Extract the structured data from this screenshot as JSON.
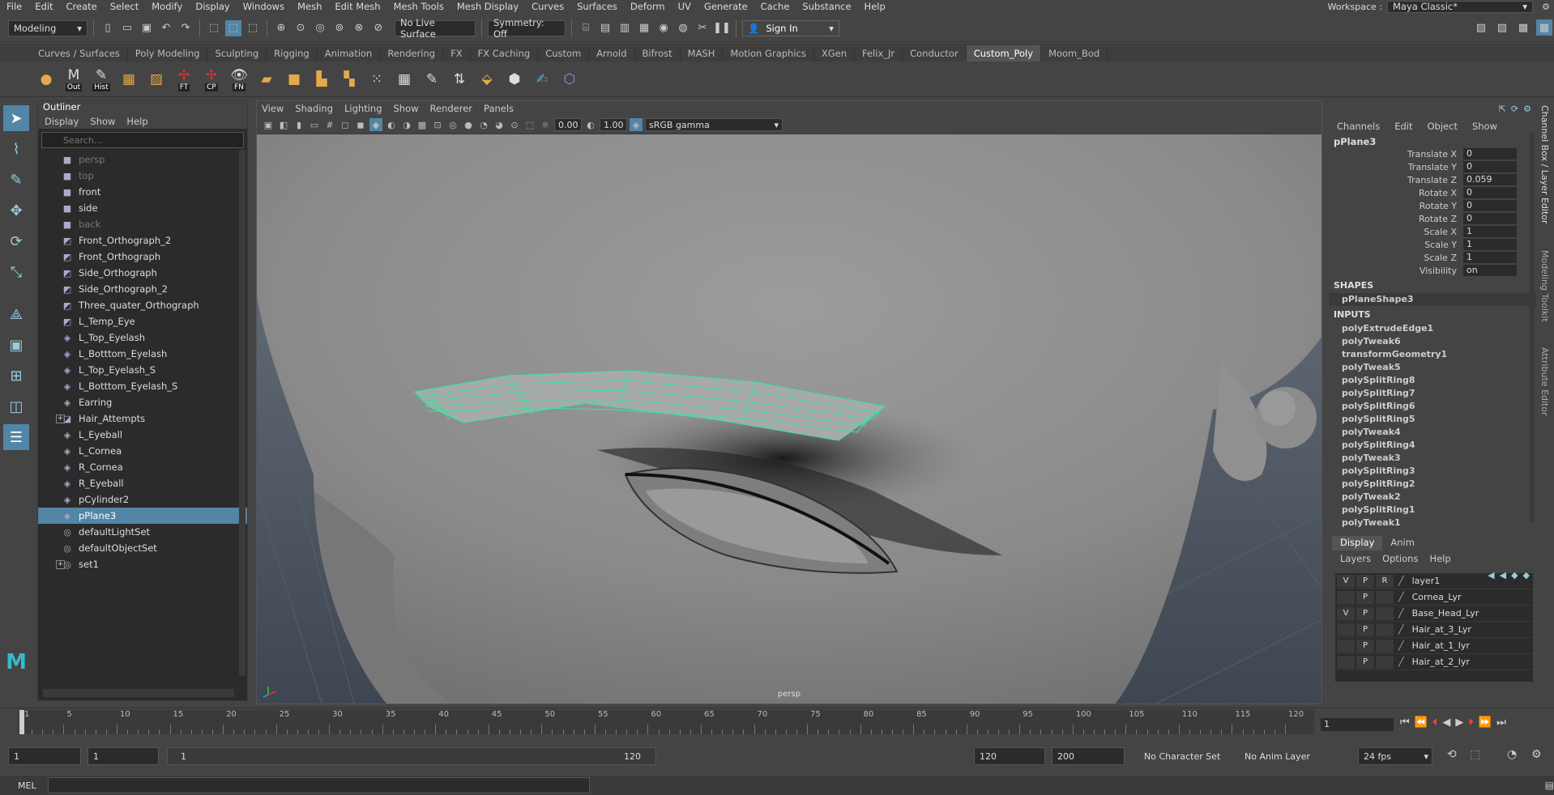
{
  "menubar": {
    "items": [
      "File",
      "Edit",
      "Create",
      "Select",
      "Modify",
      "Display",
      "Windows",
      "Mesh",
      "Edit Mesh",
      "Mesh Tools",
      "Mesh Display",
      "Curves",
      "Surfaces",
      "Deform",
      "UV",
      "Generate",
      "Cache",
      "Substance",
      "Help"
    ],
    "workspace_label": "Workspace :",
    "workspace_value": "Maya Classic*"
  },
  "statusline": {
    "mode": "Modeling",
    "live_surface": "No Live Surface",
    "symmetry": "Symmetry: Off",
    "sign_in": "Sign In"
  },
  "shelf": {
    "tabs": [
      "Curves / Surfaces",
      "Poly Modeling",
      "Sculpting",
      "Rigging",
      "Animation",
      "Rendering",
      "FX",
      "FX Caching",
      "Custom",
      "Arnold",
      "Bifrost",
      "MASH",
      "Motion Graphics",
      "XGen",
      "Felix_Jr",
      "Conductor",
      "Custom_Poly",
      "Moom_Bod"
    ],
    "active_tab": "Custom_Poly",
    "icon_labels": [
      "Out",
      "Hist",
      "FT",
      "CP",
      "FN"
    ]
  },
  "outliner": {
    "title": "Outliner",
    "menu": [
      "Display",
      "Show",
      "Help"
    ],
    "search_placeholder": "Search...",
    "items": [
      {
        "label": "persp",
        "icon": "camera-icon",
        "dim": true
      },
      {
        "label": "top",
        "icon": "camera-icon",
        "dim": true
      },
      {
        "label": "front",
        "icon": "camera-icon",
        "dim": false
      },
      {
        "label": "side",
        "icon": "camera-icon",
        "dim": false
      },
      {
        "label": "back",
        "icon": "camera-icon",
        "dim": true
      },
      {
        "label": "Front_Orthograph_2",
        "icon": "image-plane-icon"
      },
      {
        "label": "Front_Orthograph",
        "icon": "image-plane-icon"
      },
      {
        "label": "Side_Orthograph",
        "icon": "image-plane-icon"
      },
      {
        "label": "Side_Orthograph_2",
        "icon": "image-plane-icon"
      },
      {
        "label": "Three_quater_Orthograph",
        "icon": "image-plane-icon"
      },
      {
        "label": "L_Temp_Eye",
        "icon": "image-plane-icon"
      },
      {
        "label": "L_Top_Eyelash",
        "icon": "mesh-icon"
      },
      {
        "label": "L_Botttom_Eyelash",
        "icon": "mesh-icon"
      },
      {
        "label": "L_Top_Eyelash_S",
        "icon": "mesh-icon"
      },
      {
        "label": "L_Botttom_Eyelash_S",
        "icon": "mesh-icon"
      },
      {
        "label": "Earring",
        "icon": "mesh-icon"
      },
      {
        "label": "Hair_Attempts",
        "icon": "group-icon",
        "expand": "+"
      },
      {
        "label": "L_Eyeball",
        "icon": "mesh-icon"
      },
      {
        "label": "L_Cornea",
        "icon": "mesh-icon"
      },
      {
        "label": "R_Cornea",
        "icon": "mesh-icon"
      },
      {
        "label": "R_Eyeball",
        "icon": "mesh-icon"
      },
      {
        "label": "pCylinder2",
        "icon": "mesh-icon"
      },
      {
        "label": "pPlane3",
        "icon": "mesh-icon",
        "selected": true
      },
      {
        "label": "defaultLightSet",
        "icon": "set-icon"
      },
      {
        "label": "defaultObjectSet",
        "icon": "set-icon"
      },
      {
        "label": "set1",
        "icon": "set-icon",
        "expand": "+"
      }
    ]
  },
  "viewport": {
    "menu": [
      "View",
      "Shading",
      "Lighting",
      "Show",
      "Renderer",
      "Panels"
    ],
    "exposure": "0.00",
    "gamma": "1.00",
    "color_space": "sRGB gamma",
    "camera_label": "persp",
    "wire_color": "#3fe0a0"
  },
  "channelbox": {
    "menu": [
      "Channels",
      "Edit",
      "Object",
      "Show"
    ],
    "object": "pPlane3",
    "channels": [
      {
        "name": "Translate X",
        "value": "0"
      },
      {
        "name": "Translate Y",
        "value": "0"
      },
      {
        "name": "Translate Z",
        "value": "0.059"
      },
      {
        "name": "Rotate X",
        "value": "0"
      },
      {
        "name": "Rotate Y",
        "value": "0"
      },
      {
        "name": "Rotate Z",
        "value": "0"
      },
      {
        "name": "Scale X",
        "value": "1"
      },
      {
        "name": "Scale Y",
        "value": "1"
      },
      {
        "name": "Scale Z",
        "value": "1"
      },
      {
        "name": "Visibility",
        "value": "on"
      }
    ],
    "shapes_header": "SHAPES",
    "shape": "pPlaneShape3",
    "inputs_header": "INPUTS",
    "inputs": [
      "polyExtrudeEdge1",
      "polyTweak6",
      "transformGeometry1",
      "polyTweak5",
      "polySplitRing8",
      "polySplitRing7",
      "polySplitRing6",
      "polySplitRing5",
      "polyTweak4",
      "polySplitRing4",
      "polyTweak3",
      "polySplitRing3",
      "polySplitRing2",
      "polyTweak2",
      "polySplitRing1",
      "polyTweak1"
    ]
  },
  "side_tabs": [
    "Channel Box / Layer Editor",
    "Modeling Toolkit",
    "Attribute Editor"
  ],
  "layers": {
    "tabs": [
      "Display",
      "Anim"
    ],
    "menu": [
      "Layers",
      "Options",
      "Help"
    ],
    "items": [
      {
        "v": "V",
        "p": "P",
        "r": "R",
        "name": "layer1"
      },
      {
        "v": "",
        "p": "P",
        "r": "",
        "name": "Cornea_Lyr"
      },
      {
        "v": "V",
        "p": "P",
        "r": "",
        "name": "Base_Head_Lyr"
      },
      {
        "v": "",
        "p": "P",
        "r": "",
        "name": "Hair_at_3_Lyr"
      },
      {
        "v": "",
        "p": "P",
        "r": "",
        "name": "Hair_at_1_lyr"
      },
      {
        "v": "",
        "p": "P",
        "r": "",
        "name": "Hair_at_2_lyr"
      }
    ]
  },
  "timeline": {
    "ticks": [
      "1",
      "5",
      "10",
      "15",
      "20",
      "25",
      "30",
      "35",
      "40",
      "45",
      "50",
      "55",
      "60",
      "65",
      "70",
      "75",
      "80",
      "85",
      "90",
      "95",
      "100",
      "105",
      "110",
      "115",
      "120"
    ],
    "current_frame": "1"
  },
  "range": {
    "start": "1",
    "range_start": "1",
    "slider_start": "1",
    "slider_end": "120",
    "range_end": "120",
    "end": "200",
    "character_set": "No Character Set",
    "anim_layer": "No Anim Layer",
    "fps": "24 fps"
  },
  "cmdline": {
    "label": "MEL"
  }
}
